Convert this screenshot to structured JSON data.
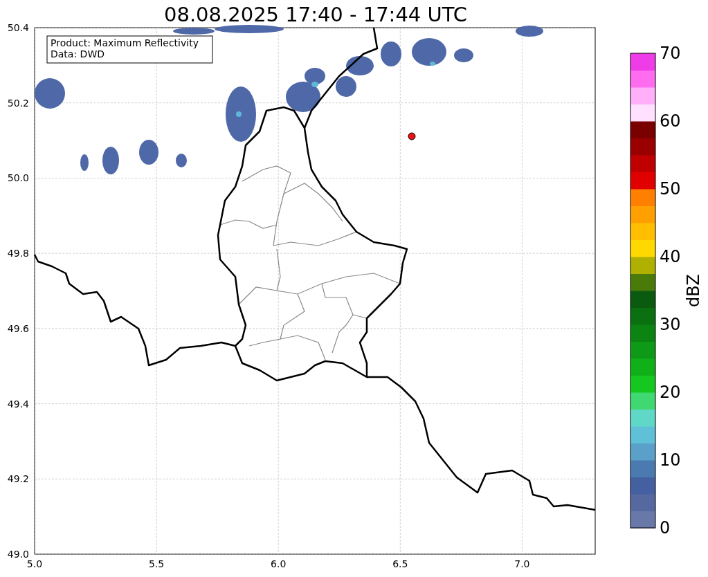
{
  "title": "08.08.2025 17:40 - 17:44 UTC",
  "info_box": [
    "Product: Maximum Reflectivity",
    "Data: DWD"
  ],
  "x_ticks": [
    "5.0",
    "5.5",
    "6.0",
    "6.5",
    "7.0"
  ],
  "y_ticks": [
    "50.4",
    "50.2",
    "50.0",
    "49.8",
    "49.6",
    "49.4",
    "49.2",
    "49.0"
  ],
  "colorbar": {
    "label": "dBZ",
    "ticks": [
      "70",
      "60",
      "50",
      "40",
      "30",
      "20",
      "10",
      "0"
    ],
    "bins": [
      {
        "color": "#6878a8"
      },
      {
        "color": "#5568a0"
      },
      {
        "color": "#4460a0"
      },
      {
        "color": "#4a7ab0"
      },
      {
        "color": "#5aa0c8"
      },
      {
        "color": "#60c0d8"
      },
      {
        "color": "#60d8c8"
      },
      {
        "color": "#40d870"
      },
      {
        "color": "#14c820"
      },
      {
        "color": "#10b018"
      },
      {
        "color": "#0e9a16"
      },
      {
        "color": "#0c8412"
      },
      {
        "color": "#0a7010"
      },
      {
        "color": "#0a5a10"
      },
      {
        "color": "#4a7a0a"
      },
      {
        "color": "#b0b000"
      },
      {
        "color": "#ffd800"
      },
      {
        "color": "#ffbf00"
      },
      {
        "color": "#ffa000"
      },
      {
        "color": "#ff8000"
      },
      {
        "color": "#e00000"
      },
      {
        "color": "#c00000"
      },
      {
        "color": "#9a0000"
      },
      {
        "color": "#7a0000"
      },
      {
        "color": "#ffe0ff"
      },
      {
        "color": "#ffb0f8"
      },
      {
        "color": "#ff6cf0"
      },
      {
        "color": "#ee3ce8"
      }
    ]
  }
}
